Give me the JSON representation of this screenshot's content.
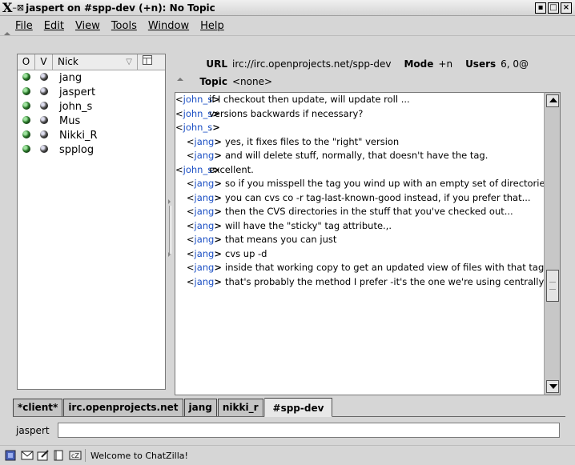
{
  "window": {
    "title": "jaspert on #spp-dev (+n): No Topic",
    "controls": [
      "▪",
      "□",
      "×"
    ]
  },
  "menu": [
    "File",
    "Edit",
    "View",
    "Tools",
    "Window",
    "Help"
  ],
  "userlist": {
    "headers": {
      "op": "O",
      "voice": "V",
      "nick": "Nick"
    },
    "users": [
      "jang",
      "jaspert",
      "john_s",
      "Mus",
      "Nikki_R",
      "spplog"
    ]
  },
  "channel": {
    "url_label": "URL",
    "url": "irc://irc.openprojects.net/spp-dev",
    "mode_label": "Mode",
    "mode": "+n",
    "users_label": "Users",
    "users": "6, 0@",
    "topic_label": "Topic",
    "topic": "<none>"
  },
  "messages": [
    {
      "nick": "john_s",
      "text": "if I checkout then update, will update roll ..."
    },
    {
      "nick": "john_s",
      "text": "versions backwards if necessary?"
    },
    {
      "nick": "john_s",
      "text": "."
    },
    {
      "nick": "jang",
      "text": "yes, it fixes files to the \"right\" version"
    },
    {
      "nick": "jang",
      "text": "and will delete stuff, normally, that doesn't have the tag."
    },
    {
      "nick": "john_s",
      "text": "excellent."
    },
    {
      "nick": "jang",
      "text": "so if you misspell the tag you wind up with an empty set of directories."
    },
    {
      "nick": "jang",
      "text": "you can cvs co -r tag-last-known-good instead, if you prefer that..."
    },
    {
      "nick": "jang",
      "text": "then the CVS directories in the stuff that you've checked out..."
    },
    {
      "nick": "jang",
      "text": "will have the \"sticky\" tag attribute.,."
    },
    {
      "nick": "jang",
      "text": "that means you can just"
    },
    {
      "nick": "jang",
      "text": "cvs up -d"
    },
    {
      "nick": "jang",
      "text": "inside that working copy to get an updated view of files with that tag"
    },
    {
      "nick": "jang",
      "text": "that's probably the method I prefer -it's the one we're using centrally"
    }
  ],
  "tabs": [
    "*client*",
    "irc.openprojects.net",
    "jang",
    "nikki_r",
    "#spp-dev"
  ],
  "input": {
    "nick": "jaspert",
    "value": ""
  },
  "status": {
    "text": "Welcome to ChatZilla!"
  }
}
